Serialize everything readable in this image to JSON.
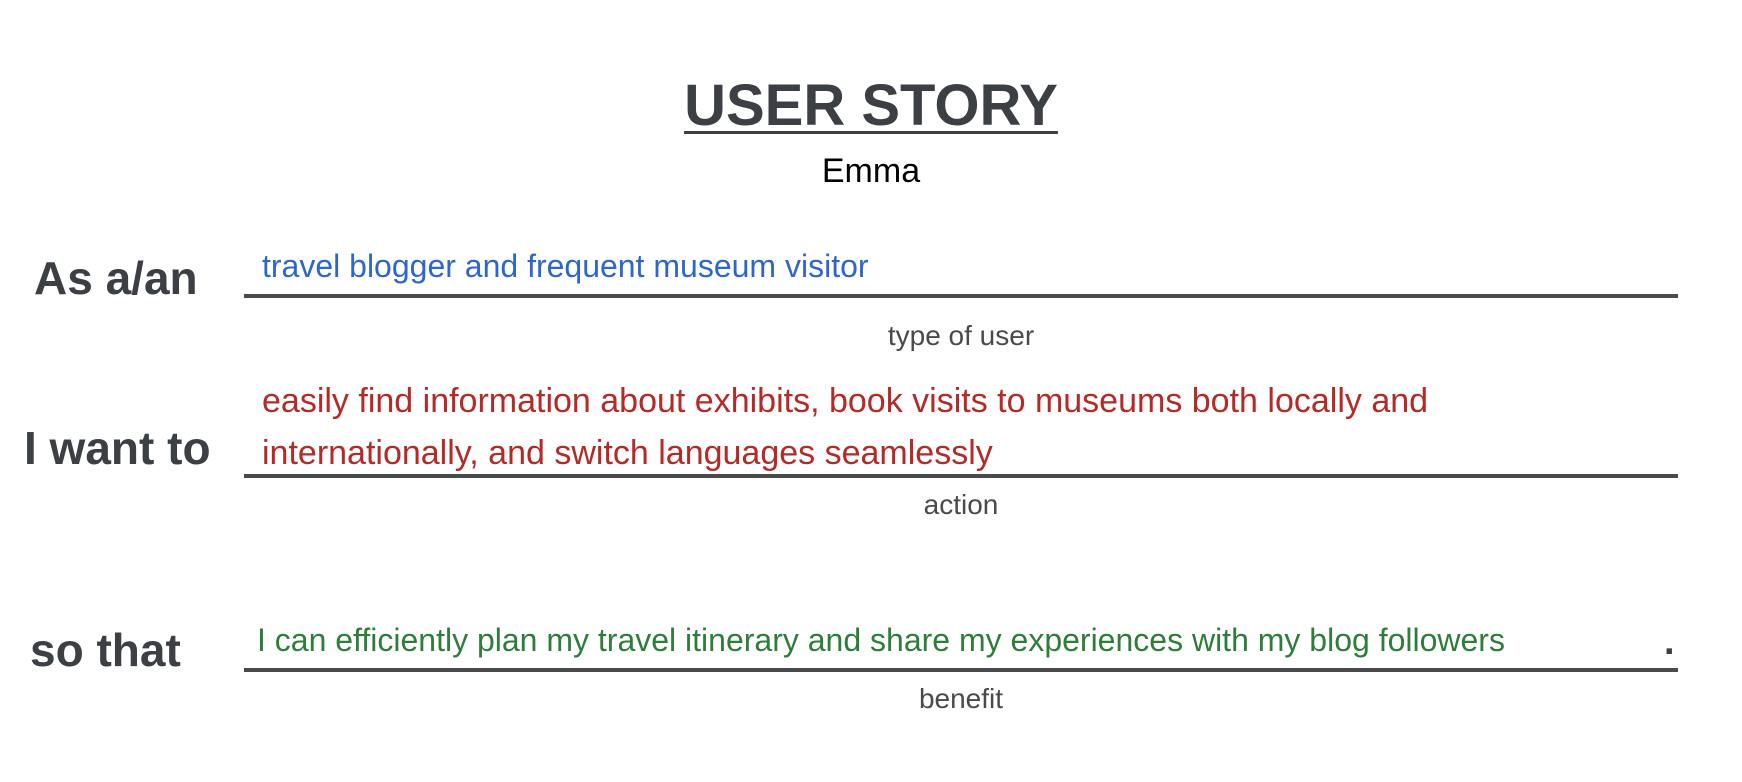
{
  "header": {
    "title": "USER STORY",
    "persona": "Emma"
  },
  "user_type": {
    "label": "As a/an",
    "value": "travel blogger and frequent museum visitor",
    "caption": "type of user",
    "color": "#2f66cc"
  },
  "action": {
    "label": "I want to",
    "line1": "easily find information about exhibits, book visits to museums both locally and",
    "line2": "internationally, and switch languages seamlessly",
    "caption": "action",
    "color": "#b42a26"
  },
  "benefit": {
    "label": "so that",
    "value": "I can efficiently plan my travel itinerary and share my experiences with my blog followers",
    "caption": "benefit",
    "color": "#2f7d3a",
    "end_punctuation": "."
  }
}
